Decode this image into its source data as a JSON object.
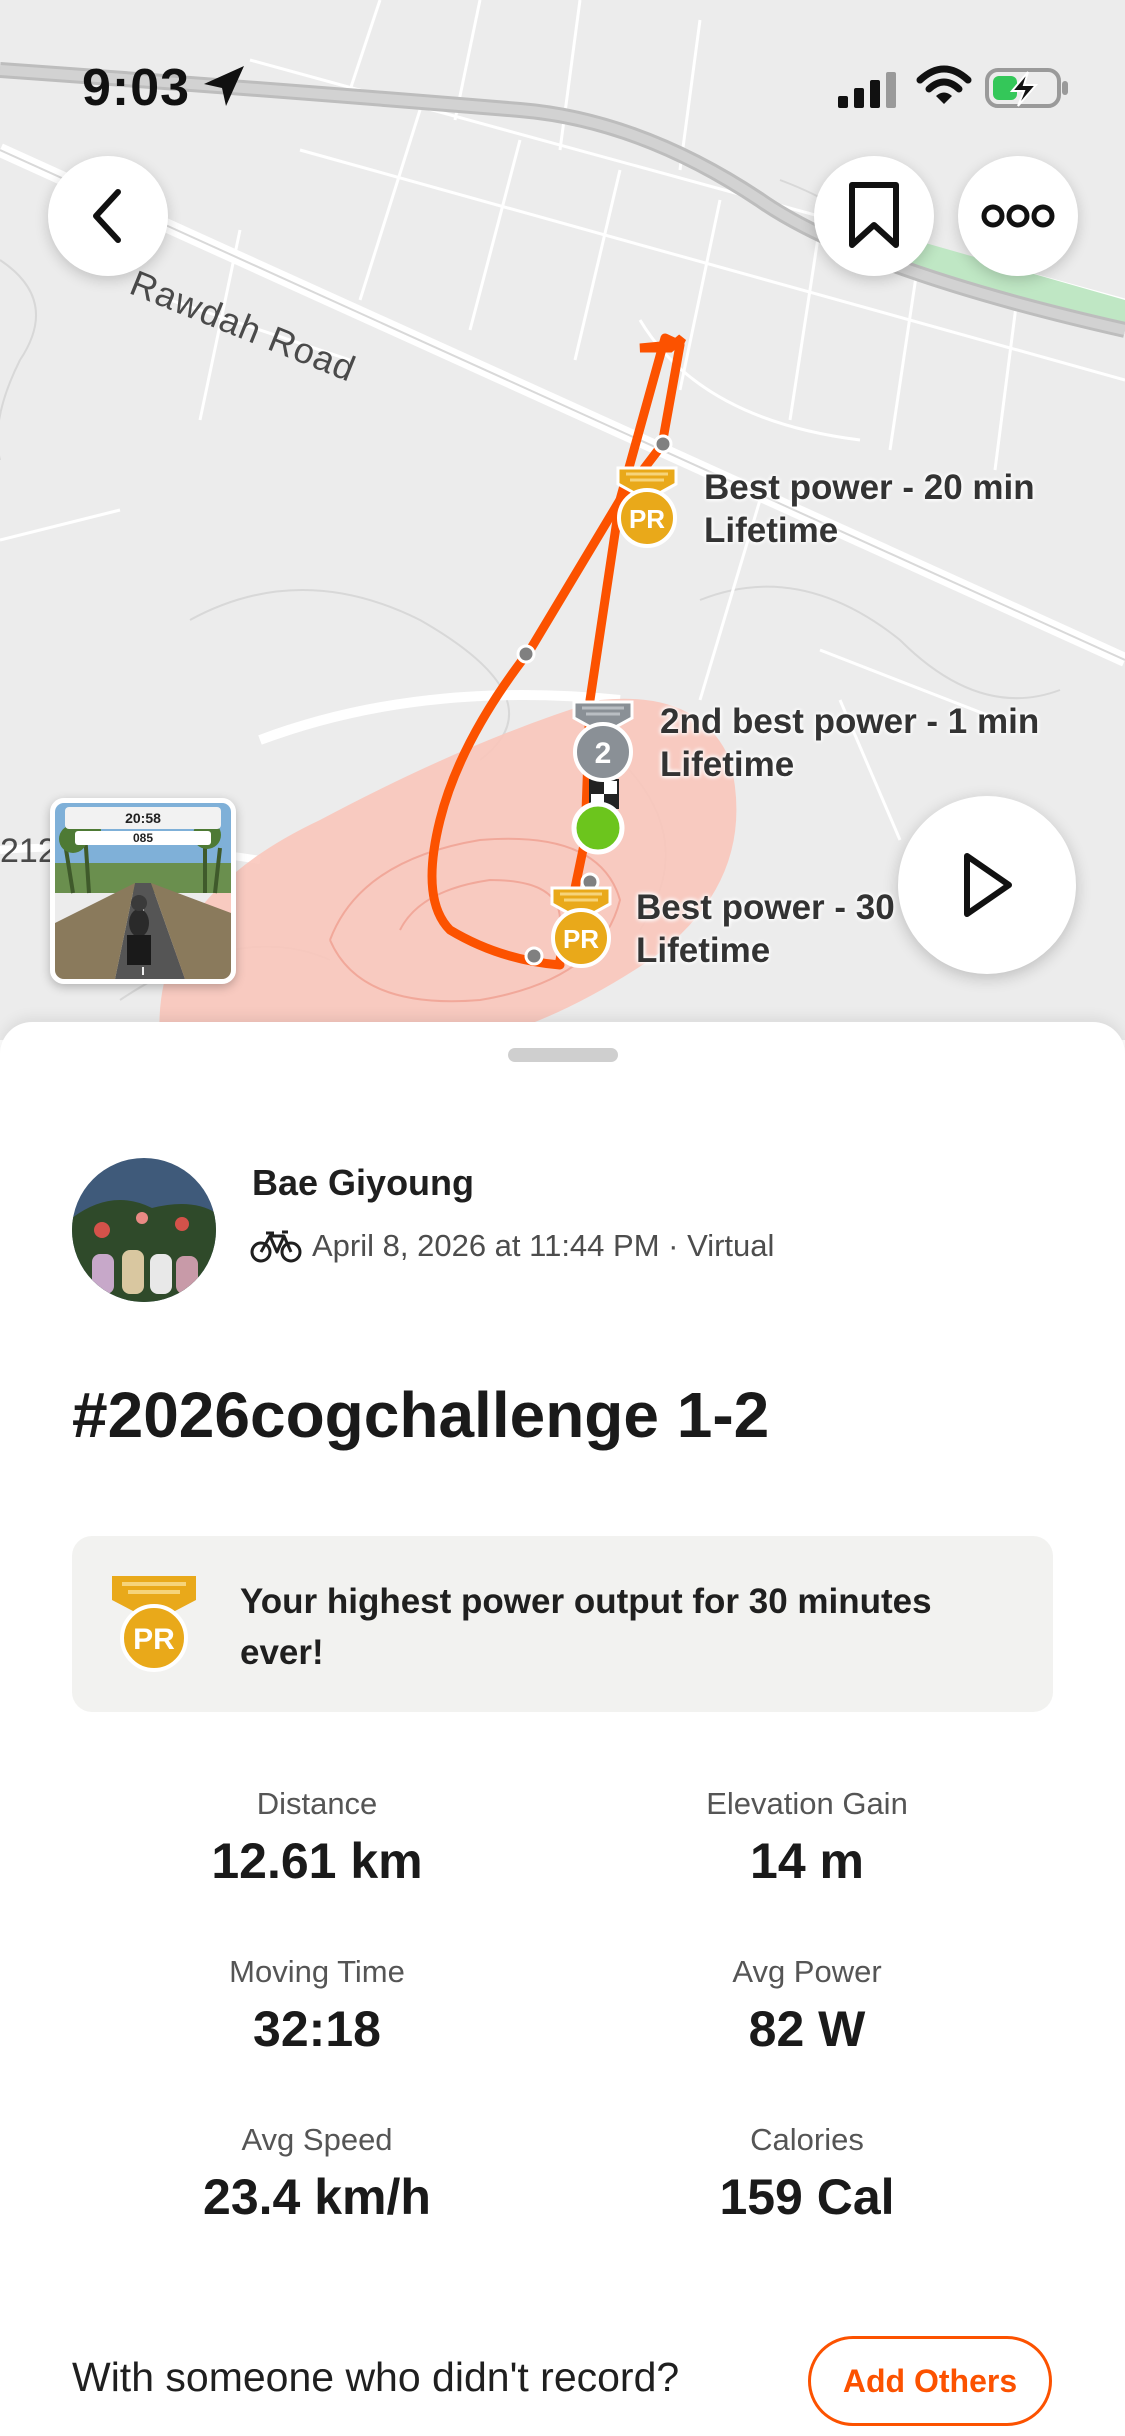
{
  "status_bar": {
    "time": "9:03",
    "icons": [
      "location-arrow-icon",
      "cellular-signal-icon",
      "wifi-icon",
      "battery-charging-icon"
    ]
  },
  "map": {
    "road_label": "Rawdah Road",
    "road_number": "212",
    "route_color": "#fc5200",
    "highlight_color": "#f9c6bb",
    "achievements": [
      {
        "badge": "PR",
        "title": "Best power - 20 min",
        "subtitle": "Lifetime"
      },
      {
        "badge": "2",
        "title": "2nd best power - 1 min",
        "subtitle": "Lifetime"
      },
      {
        "badge": "PR",
        "title": "Best power - 30",
        "subtitle": "Lifetime"
      }
    ],
    "thumbnail": {
      "time": "20:58",
      "power": "085"
    }
  },
  "toolbar": {
    "back_icon": "chevron-left-icon",
    "bookmark_icon": "bookmark-icon",
    "more_icon": "more-options-icon",
    "play_icon": "play-icon"
  },
  "activity": {
    "athlete_name": "Bae Giyoung",
    "meta": "April 8, 2026 at 11:44 PM · Virtual",
    "sport_icon": "bike-icon",
    "title": "#2026cogchallenge 1-2",
    "achievement_badge": "PR",
    "achievement_text": "Your highest power output for 30 minutes ever!",
    "stats": [
      {
        "label": "Distance",
        "value": "12.61 km"
      },
      {
        "label": "Elevation Gain",
        "value": "14 m"
      },
      {
        "label": "Moving Time",
        "value": "32:18"
      },
      {
        "label": "Avg Power",
        "value": "82 W"
      },
      {
        "label": "Avg Speed",
        "value": "23.4 km/h"
      },
      {
        "label": "Calories",
        "value": "159 Cal"
      }
    ],
    "prompt": "With someone who didn't record?",
    "add_others_label": "Add Others"
  },
  "colors": {
    "accent": "#fc5200",
    "pr_gold": "#e9a91a",
    "silver": "#8a9096",
    "start_green": "#6cc51d"
  }
}
